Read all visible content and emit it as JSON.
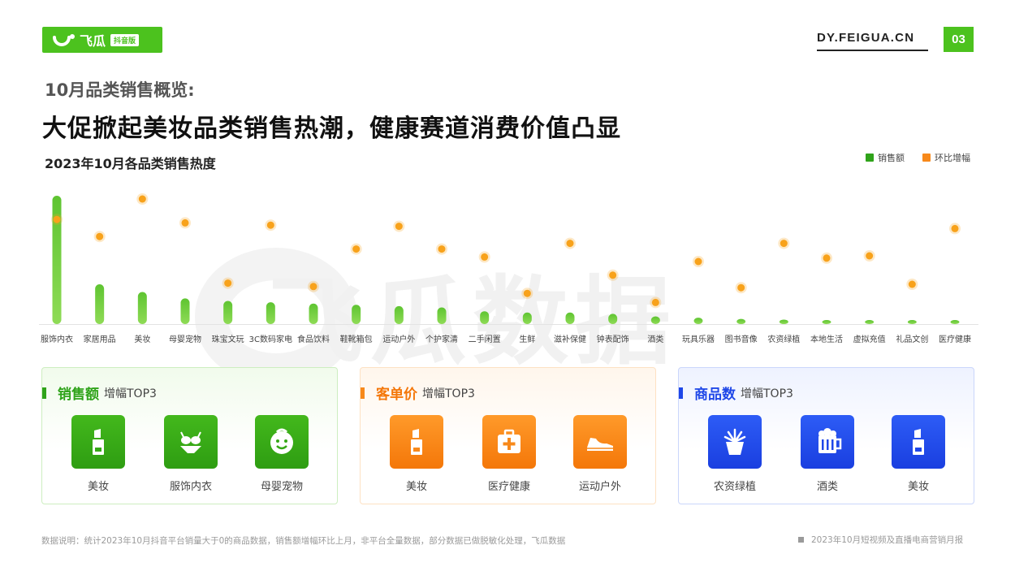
{
  "header": {
    "logo_text": "飞瓜",
    "logo_badge": "抖音版",
    "site": "DY.FEIGUA.CN",
    "page_number": "03"
  },
  "subtitle": "10月品类销售概览:",
  "title": "大促掀起美妆品类销售热潮，健康赛道消费价值凸显",
  "watermark": "飞瓜数据",
  "colors": {
    "brand_green": "#4cc21e",
    "bar_green": "#6ccc3a",
    "dot_orange": "#f8a21b",
    "panel_orange": "#f47709",
    "panel_blue": "#1f47e8"
  },
  "chart_data": {
    "type": "bar",
    "title": "2023年10月各品类销售热度",
    "categories": [
      "服饰内衣",
      "家居用品",
      "美妆",
      "母婴宠物",
      "珠宝文玩",
      "3C数码家电",
      "食品饮料",
      "鞋靴箱包",
      "运动户外",
      "个护家清",
      "二手闲置",
      "生鲜",
      "滋补保健",
      "钟表配饰",
      "酒类",
      "玩具乐器",
      "图书音像",
      "农资绿植",
      "本地生活",
      "虚拟充值",
      "礼品文创",
      "医疗健康"
    ],
    "series": [
      {
        "name": "销售额",
        "color": "#6ccc3a",
        "values": [
          100,
          31,
          25,
          20,
          18,
          17,
          16,
          15,
          14,
          13,
          10,
          9,
          9,
          8,
          6,
          5,
          4,
          3.5,
          3,
          3,
          3,
          3
        ]
      },
      {
        "name": "环比增幅",
        "color": "#f8a21b",
        "values": [
          82,
          67,
          100,
          79,
          26,
          77,
          23,
          56,
          76,
          56,
          49,
          17,
          61,
          33,
          9,
          45,
          22,
          61,
          48,
          50,
          25,
          74
        ]
      }
    ],
    "legend_position": "top-right",
    "grid": false
  },
  "panels": [
    {
      "title": "销售额",
      "suffix": "增幅TOP3",
      "items": [
        {
          "label": "美妆",
          "icon": "lipstick-icon"
        },
        {
          "label": "服饰内衣",
          "icon": "bikini-icon"
        },
        {
          "label": "母婴宠物",
          "icon": "baby-icon"
        }
      ]
    },
    {
      "title": "客单价",
      "suffix": "增幅TOP3",
      "items": [
        {
          "label": "美妆",
          "icon": "lipstick-icon"
        },
        {
          "label": "医疗健康",
          "icon": "medical-kit-icon"
        },
        {
          "label": "运动户外",
          "icon": "sneaker-icon"
        }
      ]
    },
    {
      "title": "商品数",
      "suffix": "增幅TOP3",
      "items": [
        {
          "label": "农资绿植",
          "icon": "potted-plant-icon"
        },
        {
          "label": "酒类",
          "icon": "beer-mug-icon"
        },
        {
          "label": "美妆",
          "icon": "lipstick-icon"
        }
      ]
    }
  ],
  "footnote": "数据说明：统计2023年10月抖音平台销量大于0的商品数据，销售额增幅环比上月，非平台全量数据，部分数据已做脱敏化处理，飞瓜数据",
  "footer_right": "2023年10月短视频及直播电商营销月报"
}
